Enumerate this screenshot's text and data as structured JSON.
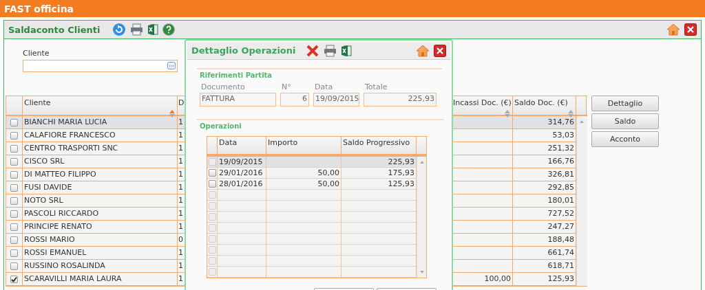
{
  "app_bar": {
    "title": "FAST officina"
  },
  "panel": {
    "title": "Saldaconto Clienti",
    "filter": {
      "label": "Cliente"
    },
    "table": {
      "columns": [
        "Cliente",
        "D",
        "Incassi Doc. (€)",
        "Saldo Doc. (€)"
      ],
      "rows": [
        {
          "checked": false,
          "selected": true,
          "cliente": "BIANCHI MARIA LUCIA",
          "col_2": "1",
          "saldo": "314,76"
        },
        {
          "checked": false,
          "selected": false,
          "cliente": "CALAFIORE FRANCESCO",
          "col_2": "1",
          "saldo": "53,03"
        },
        {
          "checked": false,
          "selected": false,
          "cliente": "CENTRO TRASPORTI SNC",
          "col_2": "1",
          "saldo": "251,32"
        },
        {
          "checked": false,
          "selected": false,
          "cliente": "CISCO SRL",
          "col_2": "1",
          "saldo": "166,76"
        },
        {
          "checked": false,
          "selected": false,
          "cliente": "DI MATTEO FILIPPO",
          "col_2": "1",
          "saldo": "326,81"
        },
        {
          "checked": false,
          "selected": false,
          "cliente": "FUSI DAVIDE",
          "col_2": "1",
          "saldo": "292,85"
        },
        {
          "checked": false,
          "selected": false,
          "cliente": "NOTO SRL",
          "col_2": "1",
          "saldo": "180,01"
        },
        {
          "checked": false,
          "selected": false,
          "cliente": "PASCOLI RICCARDO",
          "col_2": "1",
          "saldo": "727,52"
        },
        {
          "checked": false,
          "selected": false,
          "cliente": "PRINCIPE RENATO",
          "col_2": "1",
          "saldo": "247,27"
        },
        {
          "checked": false,
          "selected": false,
          "cliente": "ROSSI MARIO",
          "col_2": "0",
          "saldo": "188,48"
        },
        {
          "checked": false,
          "selected": false,
          "cliente": "ROSSI EMANUEL",
          "col_2": "1",
          "saldo": "661,74"
        },
        {
          "checked": false,
          "selected": false,
          "cliente": "RUSSINO ROSALINDA",
          "col_2": "1",
          "saldo": "618,71"
        },
        {
          "checked": true,
          "selected": false,
          "cliente": "SCARAVILLI MARIA LAURA",
          "col_2": "1",
          "incassi": "100,00",
          "saldo": "125,93"
        }
      ]
    },
    "buttons": [
      "Dettaglio",
      "Saldo",
      "Acconto"
    ]
  },
  "dialog": {
    "title": "Dettaglio Operazioni",
    "riferimenti": {
      "heading": "Riferimenti Partita",
      "fields": [
        {
          "label": "Documento",
          "value": "FATTURA",
          "kind": "text"
        },
        {
          "label": "N°",
          "value": "6",
          "kind": "number"
        },
        {
          "label": "Data",
          "value": "19/09/2015",
          "kind": "text"
        },
        {
          "label": "Totale",
          "value": "225,93",
          "kind": "number"
        }
      ]
    },
    "operazioni": {
      "heading": "Operazioni",
      "columns": [
        "Data",
        "Importo",
        "Saldo Progressivo"
      ],
      "rows": [
        {
          "checked": false,
          "selected": true,
          "data": "19/09/2015",
          "saldo": "225,93"
        },
        {
          "checked": false,
          "selected": false,
          "data": "29/01/2016",
          "importo": "50,00",
          "saldo": "175,93"
        },
        {
          "checked": false,
          "selected": false,
          "data": "28/01/2016",
          "importo": "50,00",
          "saldo": "125,93"
        },
        {
          "checked": false,
          "selected": false
        },
        {
          "checked": false,
          "selected": false
        },
        {
          "checked": false,
          "selected": false
        },
        {
          "checked": false,
          "selected": false
        },
        {
          "checked": false,
          "selected": false
        },
        {
          "checked": false,
          "selected": false
        },
        {
          "checked": false,
          "selected": false
        },
        {
          "checked": false,
          "selected": false
        }
      ]
    }
  }
}
